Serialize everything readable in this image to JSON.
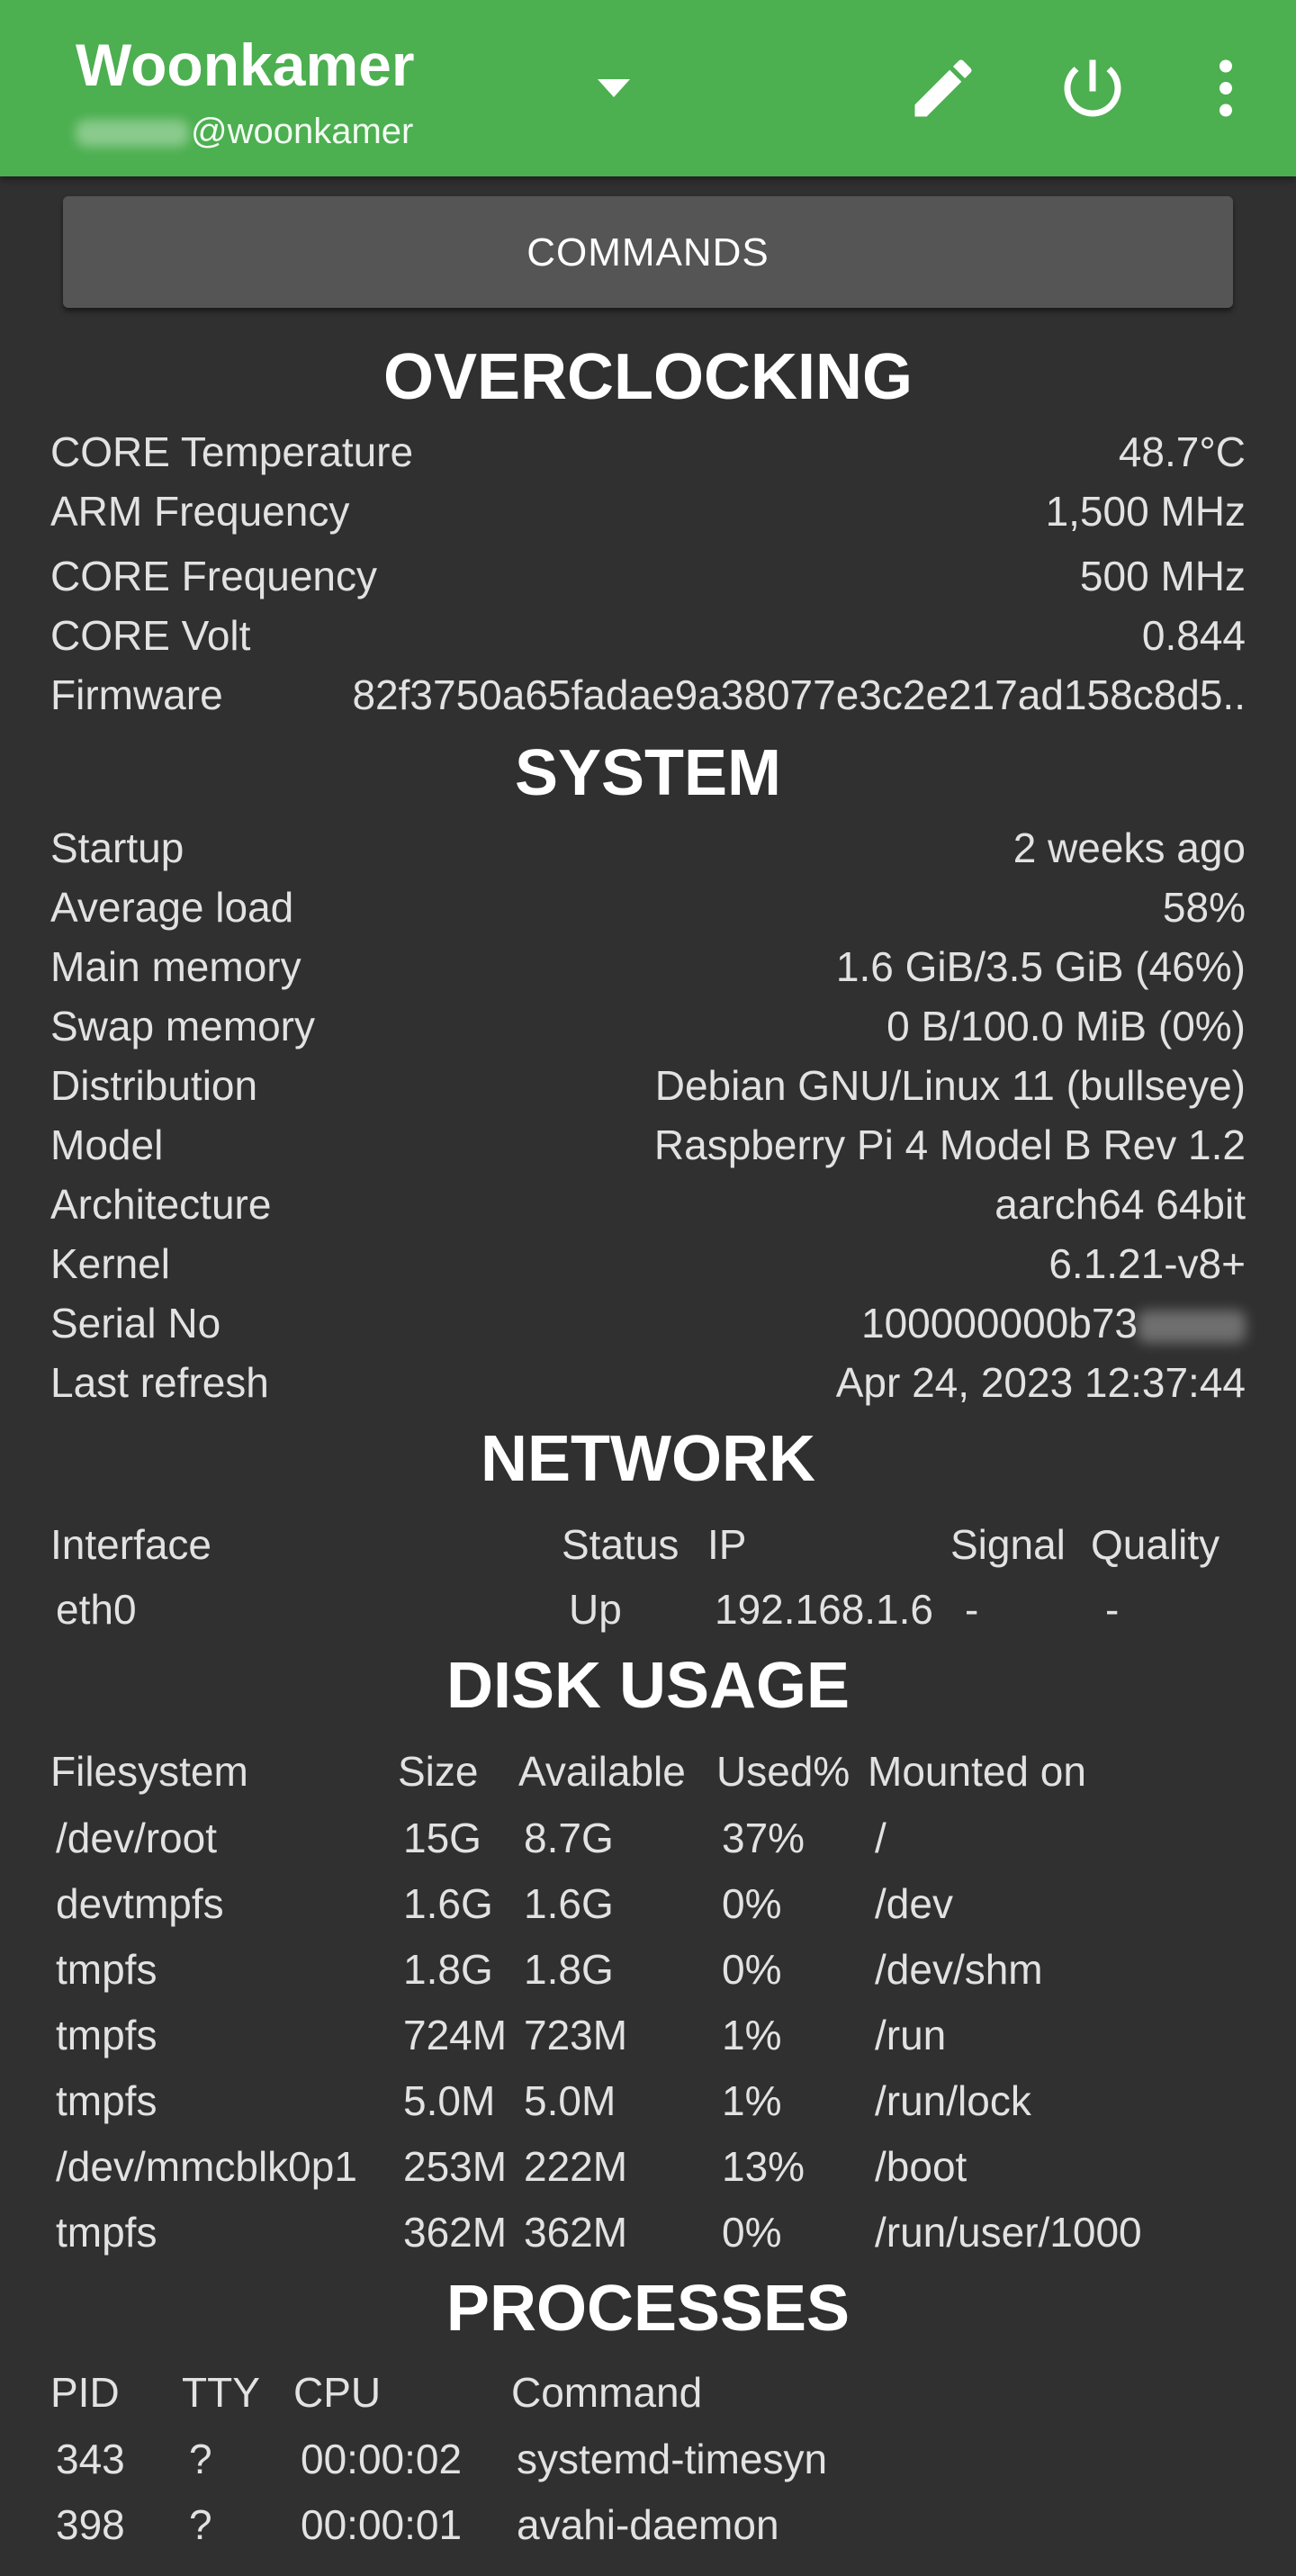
{
  "toolbar": {
    "title": "Woonkamer",
    "subtitle_host": "@woonkamer",
    "icons": {
      "dropdown": "dropdown-arrow-icon",
      "edit": "pencil-icon",
      "power": "power-icon",
      "menu": "more-vert-icon"
    }
  },
  "commands_label": "COMMANDS",
  "overclocking": {
    "title": "OVERCLOCKING",
    "rows": [
      {
        "label": "CORE Temperature",
        "value": "48.7°C"
      },
      {
        "label": "ARM Frequency",
        "value": "1,500 MHz"
      },
      {
        "label": "CORE Frequency",
        "value": "500 MHz"
      },
      {
        "label": "CORE Volt",
        "value": "0.844"
      },
      {
        "label": "Firmware",
        "value": "82f3750a65fadae9a38077e3c2e217ad158c8d5.."
      }
    ]
  },
  "system": {
    "title": "SYSTEM",
    "rows": [
      {
        "label": "Startup",
        "value": "2 weeks ago"
      },
      {
        "label": "Average load",
        "value": "58%"
      },
      {
        "label": "Main memory",
        "value": "1.6 GiB/3.5 GiB (46%)"
      },
      {
        "label": "Swap memory",
        "value": "0 B/100.0 MiB (0%)"
      },
      {
        "label": "Distribution",
        "value": "Debian GNU/Linux 11 (bullseye)"
      },
      {
        "label": "Model",
        "value": "Raspberry Pi 4 Model B Rev 1.2"
      },
      {
        "label": "Architecture",
        "value": "aarch64 64bit"
      },
      {
        "label": "Kernel",
        "value": "6.1.21-v8+"
      },
      {
        "label": "Serial No",
        "value": "100000000b73"
      },
      {
        "label": "Last refresh",
        "value": "Apr 24, 2023 12:37:44"
      }
    ]
  },
  "network": {
    "title": "NETWORK",
    "headers": [
      "Interface",
      "Status",
      "IP",
      "Signal",
      "Quality"
    ],
    "rows": [
      [
        "eth0",
        "Up",
        "192.168.1.6",
        "-",
        "-"
      ]
    ]
  },
  "disk": {
    "title": "DISK USAGE",
    "headers": [
      "Filesystem",
      "Size",
      "Available",
      "Used%",
      "Mounted on"
    ],
    "rows": [
      [
        "/dev/root",
        "15G",
        "8.7G",
        "37%",
        "/"
      ],
      [
        "devtmpfs",
        "1.6G",
        "1.6G",
        "0%",
        "/dev"
      ],
      [
        "tmpfs",
        "1.8G",
        "1.8G",
        "0%",
        "/dev/shm"
      ],
      [
        "tmpfs",
        "724M",
        "723M",
        "1%",
        "/run"
      ],
      [
        "tmpfs",
        "5.0M",
        "5.0M",
        "1%",
        "/run/lock"
      ],
      [
        "/dev/mmcblk0p1",
        "253M",
        "222M",
        "13%",
        "/boot"
      ],
      [
        "tmpfs",
        "362M",
        "362M",
        "0%",
        "/run/user/1000"
      ]
    ]
  },
  "processes": {
    "title": "PROCESSES",
    "headers": [
      "PID",
      "TTY",
      "CPU",
      "Command"
    ],
    "rows": [
      [
        "343",
        "?",
        "00:00:02",
        "systemd-timesyn"
      ],
      [
        "398",
        "?",
        "00:00:01",
        "avahi-daemon"
      ]
    ]
  }
}
